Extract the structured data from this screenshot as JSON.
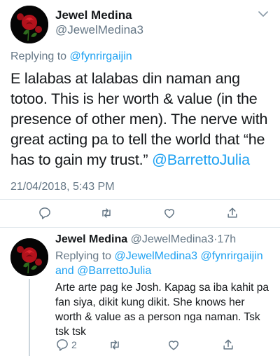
{
  "main_tweet": {
    "display_name": "Jewel Medina",
    "handle": "@JewelMedina3",
    "replying_prefix": "Replying to",
    "replying_to": "@fynrirgaijin",
    "text_plain": "E lalabas at lalabas din naman ang totoo. This is her worth & value (in the presence of other men). The nerve with great acting pa to tell the world that “he has to gain my trust.”",
    "text_mention": "@BarrettoJulia",
    "timestamp": "21/04/2018, 5:43 PM",
    "avatar_icon": "rose-avatar-icon",
    "menu_icon": "chevron-down-icon"
  },
  "main_actions": [
    {
      "name": "reply-icon"
    },
    {
      "name": "retweet-icon"
    },
    {
      "name": "like-icon"
    },
    {
      "name": "share-icon"
    }
  ],
  "reply_tweet": {
    "display_name": "Jewel Medina",
    "handle": "@JewelMedina3",
    "separator": "·",
    "time": "17h",
    "replying_prefix": "Replying to",
    "replying_to_1": "@JewelMedina3",
    "replying_to_2": "@fynrirgaijin",
    "and_word": "and",
    "replying_to_3": "@BarrettoJulia",
    "text": "Arte arte pag ke Josh. Kapag sa iba kahit pa fan siya, dikit kung dikit. She knows her worth & value as a person nga naman. Tsk tsk tsk",
    "avatar_icon": "rose-avatar-icon"
  },
  "reply_actions": {
    "reply_count": "2"
  },
  "colors": {
    "link": "#1da1f2",
    "secondary_text": "#657786",
    "divider": "#e1e8ed",
    "primary_text": "#14171a"
  }
}
